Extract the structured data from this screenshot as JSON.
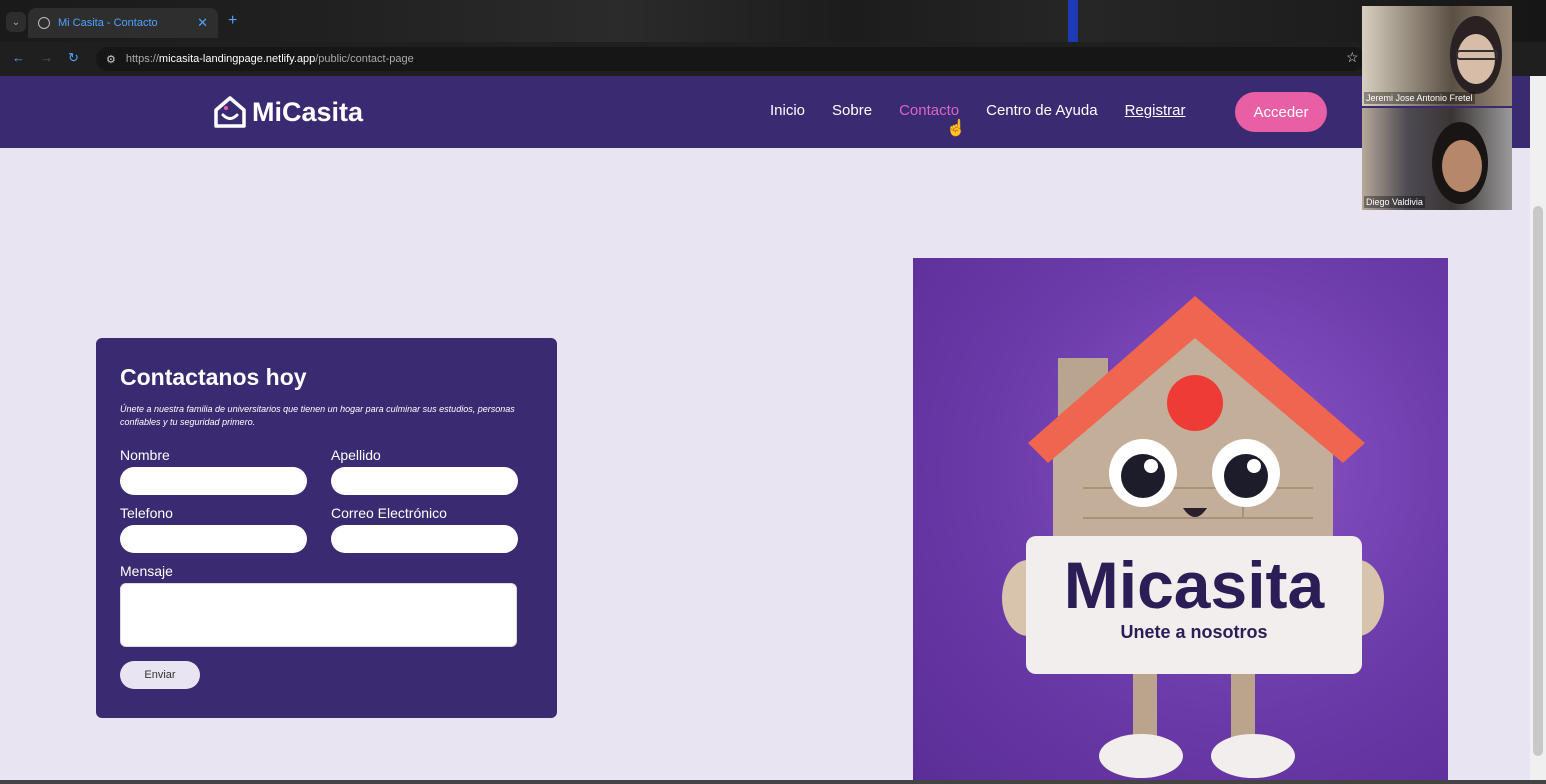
{
  "browser": {
    "tab_title": "Mi Casita - Contacto",
    "url_prefix": "https://",
    "url_host": "micasita-landingpage.netlify.app",
    "url_path": "/public/contact-page"
  },
  "navbar": {
    "logo_text": "MiCasita",
    "links": [
      "Inicio",
      "Sobre",
      "Contacto",
      "Centro de Ayuda",
      "Registrar"
    ],
    "cta_label": "Acceder"
  },
  "form": {
    "title": "Contactanos hoy",
    "description": "Únete a nuestra familia de universitarios que tienen un hogar para culminar sus estudios, personas confiables y tu seguridad primero.",
    "fields": {
      "nombre": "Nombre",
      "apellido": "Apellido",
      "telefono": "Telefono",
      "correo": "Correo Electrónico",
      "mensaje": "Mensaje"
    },
    "submit_label": "Enviar"
  },
  "hero": {
    "sign_title": "Micasita",
    "sign_subtitle": "Unete a nosotros"
  },
  "video_call": {
    "participants": [
      "Jeremi Jose Antonio Fretel",
      "Diego Valdivia"
    ]
  },
  "colors": {
    "brand_purple": "#3a2a72",
    "accent_pink": "#e85fa6",
    "active_link": "#d867c6",
    "page_bg": "#e8e4f2"
  },
  "icons": [
    "tab-menu-icon",
    "globe-icon",
    "close-icon",
    "plus-icon",
    "back-icon",
    "forward-icon",
    "reload-icon",
    "tune-icon",
    "star-icon",
    "house-logo-icon",
    "pointer-cursor-icon"
  ]
}
